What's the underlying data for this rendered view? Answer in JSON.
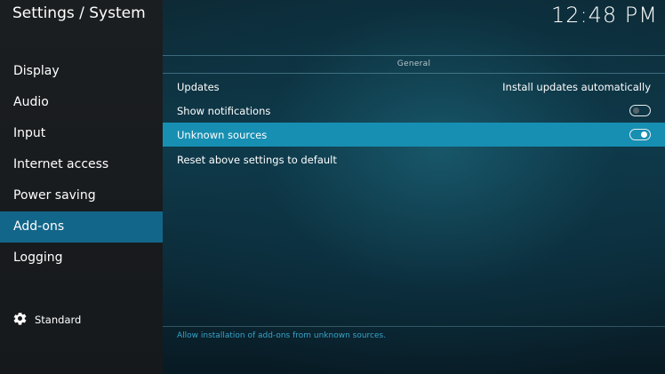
{
  "window": {
    "title": "Settings / System",
    "clock": "12:48 PM"
  },
  "sidebar": {
    "items": [
      {
        "label": "Display",
        "active": false
      },
      {
        "label": "Audio",
        "active": false
      },
      {
        "label": "Input",
        "active": false
      },
      {
        "label": "Internet access",
        "active": false
      },
      {
        "label": "Power saving",
        "active": false
      },
      {
        "label": "Add-ons",
        "active": true
      },
      {
        "label": "Logging",
        "active": false
      }
    ],
    "settings_level": {
      "icon": "gear-icon",
      "label": "Standard"
    }
  },
  "main": {
    "group_title": "General",
    "settings": [
      {
        "label": "Updates",
        "value": "Install updates automatically"
      },
      {
        "label": "Show notifications",
        "toggle": "off"
      },
      {
        "label": "Unknown sources",
        "toggle": "on",
        "selected": true
      },
      {
        "label": "Reset above settings to default"
      }
    ],
    "description": "Allow installation of add-ons from unknown sources."
  },
  "colors": {
    "accent_selected": "#178fb3",
    "sidebar_active": "#12668a",
    "description_text": "#39a3c9"
  }
}
